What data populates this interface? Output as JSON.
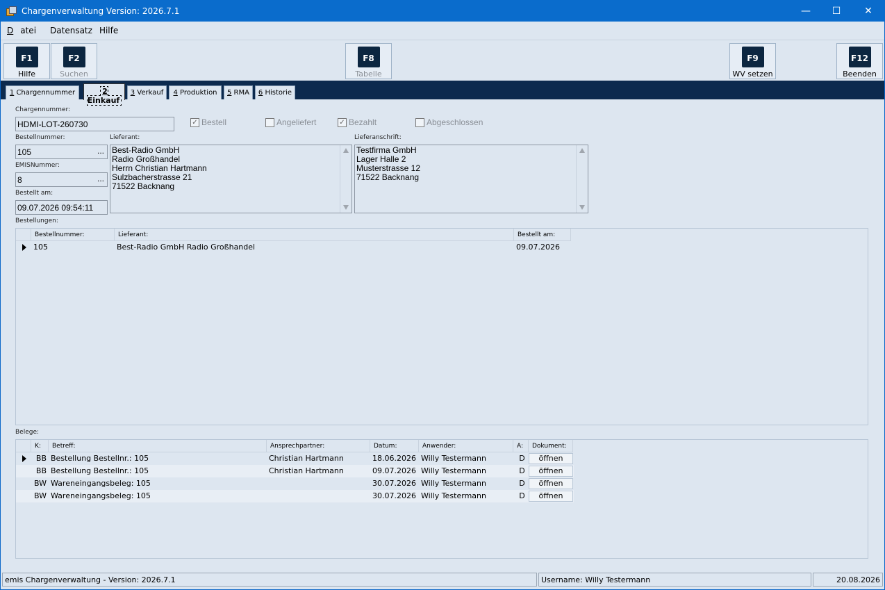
{
  "window": {
    "title": "Chargenverwaltung Version: 2026.7.1",
    "minimize": "—",
    "maximize": "☐",
    "close": "✕"
  },
  "menu": [
    {
      "label": "Datei",
      "accel": "D",
      "rest": "atei"
    },
    {
      "label": "Datensatz",
      "accel": "",
      "rest": "Datensatz"
    },
    {
      "label": "Hilfe",
      "accel": "",
      "rest": "Hilfe"
    }
  ],
  "toolbar": {
    "f1": {
      "key": "F1",
      "label": "Hilfe"
    },
    "f2": {
      "key": "F2",
      "label": "Suchen"
    },
    "f8": {
      "key": "F8",
      "label": "Tabelle"
    },
    "f9": {
      "key": "F9",
      "label": "WV setzen"
    },
    "f12": {
      "key": "F12",
      "label": "Beenden"
    }
  },
  "tabs": [
    {
      "num": "1",
      "label": " Chargennummer"
    },
    {
      "num": "2",
      "label": " Einkauf"
    },
    {
      "num": "3",
      "label": " Verkauf"
    },
    {
      "num": "4",
      "label": " Produktion"
    },
    {
      "num": "5",
      "label": " RMA"
    },
    {
      "num": "6",
      "label": " Historie"
    }
  ],
  "form": {
    "chargennummer_label": "Chargennummer:",
    "chargennummer": "HDMI-LOT-260730",
    "checks": {
      "bestell": {
        "label": "Bestell",
        "checked": "✓"
      },
      "angeliefert": {
        "label": "Angeliefert",
        "checked": ""
      },
      "bezahlt": {
        "label": "Bezahlt",
        "checked": "✓"
      },
      "abgeschlossen": {
        "label": "Abgeschlossen",
        "checked": ""
      }
    },
    "bestellnummer_label": "Bestellnummer:",
    "bestellnummer": "105",
    "emis_label": "EMISNummer:",
    "emis": "8",
    "bestellt_label": "Bestellt am:",
    "bestellt_am": "09.07.2026 09:54:11",
    "ellipsis": "...",
    "lieferant_label": "Lieferant:",
    "lieferant_lines": [
      "Best-Radio GmbH",
      "Radio Großhandel",
      "Herrn Christian Hartmann",
      "Sulzbacherstrasse 21",
      "71522 Backnang"
    ],
    "lieferanschrift_label": "Lieferanschrift:",
    "lieferanschrift_lines": [
      "Testfirma GmbH",
      "Lager Halle 2",
      "Musterstrasse 12",
      "71522 Backnang"
    ]
  },
  "bestellungen": {
    "label": "Bestellungen:",
    "headers": [
      "Bestellnummer:",
      "Lieferant:",
      "Bestellt am:"
    ],
    "rows": [
      {
        "nr": "105",
        "lieferant": "Best-Radio GmbH Radio Großhandel",
        "datum": "09.07.2026"
      }
    ]
  },
  "belege": {
    "label": "Belege:",
    "headers": [
      "K:",
      "Betreff:",
      "Ansprechpartner:",
      "Datum:",
      "Anwender:",
      "A:",
      "Dokument:"
    ],
    "rows": [
      {
        "k": "BB",
        "betreff": "Bestellung Bestellnr.: 105",
        "partner": "Christian Hartmann",
        "datum": "18.06.2026",
        "anwender": "Willy Testermann",
        "a": "D",
        "doc": "öffnen"
      },
      {
        "k": "BB",
        "betreff": "Bestellung Bestellnr.: 105",
        "partner": "Christian Hartmann",
        "datum": "09.07.2026",
        "anwender": "Willy Testermann",
        "a": "D",
        "doc": "öffnen"
      },
      {
        "k": "BW",
        "betreff": "Wareneingangsbeleg: 105",
        "partner": "",
        "datum": "30.07.2026",
        "anwender": "Willy Testermann",
        "a": "D",
        "doc": "öffnen"
      },
      {
        "k": "BW",
        "betreff": "Wareneingangsbeleg: 105",
        "partner": "",
        "datum": "30.07.2026",
        "anwender": "Willy Testermann",
        "a": "D",
        "doc": "öffnen"
      }
    ]
  },
  "statusbar": {
    "app": "emis Chargenverwaltung - Version: 2026.7.1",
    "user": "Username: Willy Testermann",
    "date": "20.08.2026"
  }
}
